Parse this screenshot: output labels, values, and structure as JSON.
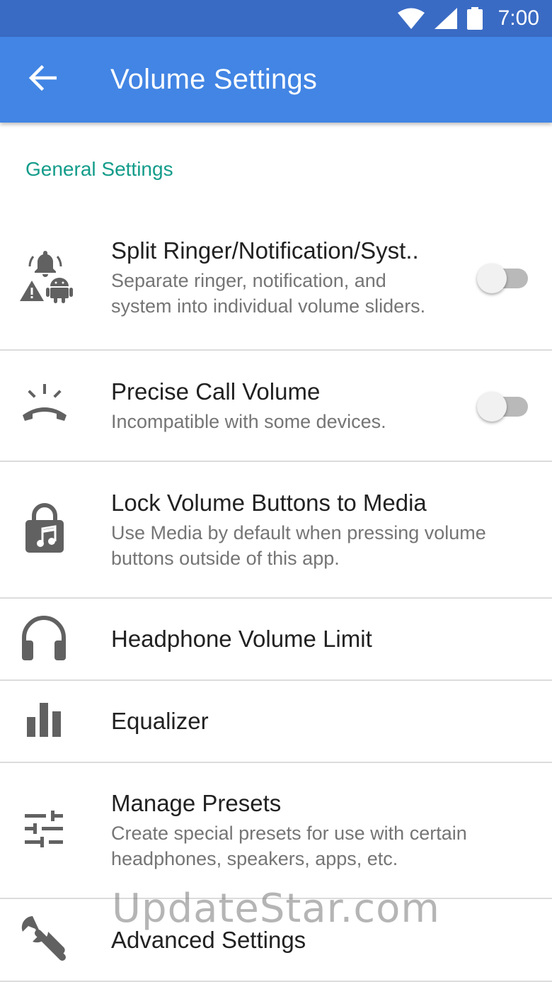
{
  "status_bar": {
    "time": "7:00",
    "icons": [
      "wifi-icon",
      "signal-icon",
      "battery-icon"
    ]
  },
  "app_bar": {
    "title": "Volume Settings",
    "back_icon": "arrow-back-icon"
  },
  "section": {
    "title": "General Settings"
  },
  "items": [
    {
      "icon": "ringer-notification-system-icon",
      "title": "Split Ringer/Notification/Syst..",
      "summary": "Separate ringer, notification, and system into individual volume sliders.",
      "toggle": false
    },
    {
      "icon": "call-volume-icon",
      "title": "Precise Call Volume",
      "summary": "Incompatible with some devices.",
      "toggle": false
    },
    {
      "icon": "lock-music-icon",
      "title": "Lock Volume Buttons to Media",
      "summary": "Use Media by default when pressing volume buttons outside of this app."
    },
    {
      "icon": "headphones-icon",
      "title": "Headphone Volume Limit"
    },
    {
      "icon": "equalizer-icon",
      "title": "Equalizer"
    },
    {
      "icon": "tune-icon",
      "title": "Manage Presets",
      "summary": "Create special presets for use with certain headphones, speakers, apps, etc."
    },
    {
      "icon": "wrench-icon",
      "title": "Advanced Settings"
    }
  ],
  "watermark": "UpdateStar.com",
  "colors": {
    "status_bar": "#3a6bc4",
    "app_bar": "#4285e4",
    "section_header": "#139c8a",
    "icon": "#616161"
  }
}
